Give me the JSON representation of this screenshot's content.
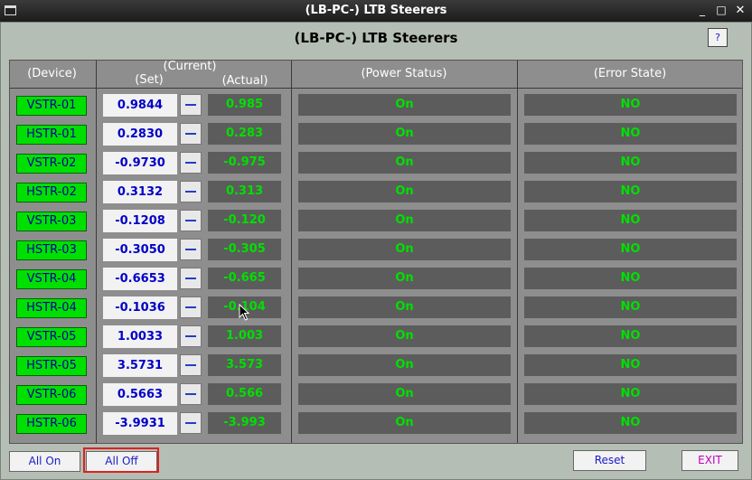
{
  "window": {
    "title": "(LB-PC-) LTB Steerers",
    "min_glyph": "_",
    "max_glyph": "□",
    "close_glyph": "✕"
  },
  "header": {
    "title": "(LB-PC-) LTB Steerers",
    "help_label": "?"
  },
  "columns": {
    "device": "(Device)",
    "current": "(Current)",
    "set": "(Set)",
    "actual": "(Actual)",
    "power": "(Power Status)",
    "error": "(Error State)"
  },
  "rows": [
    {
      "device": "VSTR-01",
      "set": "0.9844",
      "actual": "0.985",
      "power": "On",
      "error": "NO"
    },
    {
      "device": "HSTR-01",
      "set": "0.2830",
      "actual": "0.283",
      "power": "On",
      "error": "NO"
    },
    {
      "device": "VSTR-02",
      "set": "-0.9730",
      "actual": "-0.975",
      "power": "On",
      "error": "NO"
    },
    {
      "device": "HSTR-02",
      "set": "0.3132",
      "actual": "0.313",
      "power": "On",
      "error": "NO"
    },
    {
      "device": "VSTR-03",
      "set": "-0.1208",
      "actual": "-0.120",
      "power": "On",
      "error": "NO"
    },
    {
      "device": "HSTR-03",
      "set": "-0.3050",
      "actual": "-0.305",
      "power": "On",
      "error": "NO"
    },
    {
      "device": "VSTR-04",
      "set": "-0.6653",
      "actual": "-0.665",
      "power": "On",
      "error": "NO"
    },
    {
      "device": "HSTR-04",
      "set": "-0.1036",
      "actual": "-0.104",
      "power": "On",
      "error": "NO"
    },
    {
      "device": "VSTR-05",
      "set": "1.0033",
      "actual": "1.003",
      "power": "On",
      "error": "NO"
    },
    {
      "device": "HSTR-05",
      "set": "3.5731",
      "actual": "3.573",
      "power": "On",
      "error": "NO"
    },
    {
      "device": "VSTR-06",
      "set": "0.5663",
      "actual": "0.566",
      "power": "On",
      "error": "NO"
    },
    {
      "device": "HSTR-06",
      "set": "-3.9931",
      "actual": "-3.993",
      "power": "On",
      "error": "NO"
    }
  ],
  "footer": {
    "all_on": "All On",
    "all_off": "All Off",
    "reset": "Reset",
    "exit": "EXIT"
  },
  "colors": {
    "device_button": "#00e000",
    "status_text": "#00e000",
    "set_text": "#0000c8",
    "exit_text": "#c000c0",
    "highlight": "#e02020"
  }
}
